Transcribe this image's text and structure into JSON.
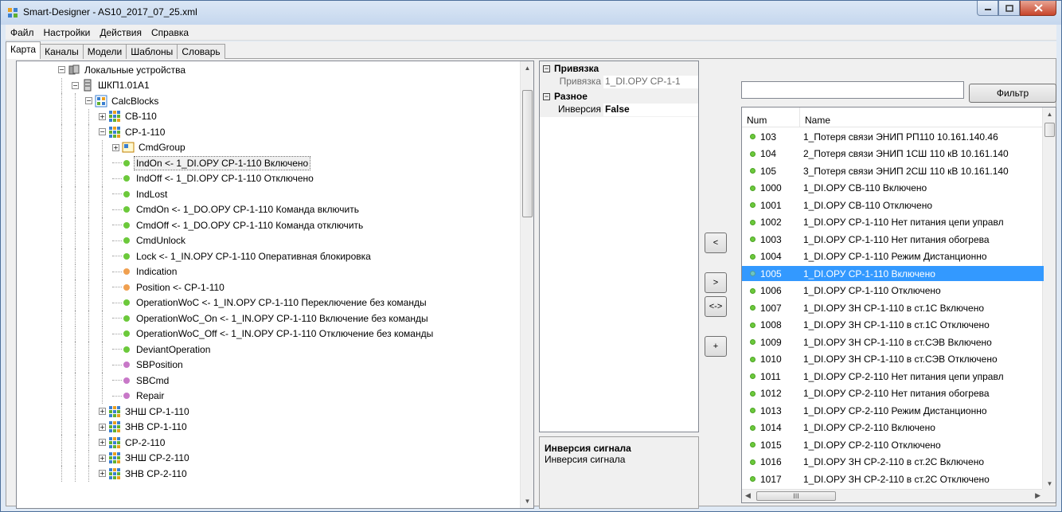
{
  "window": {
    "title": "Smart-Designer - AS10_2017_07_25.xml"
  },
  "menu": [
    "Файл",
    "Настройки",
    "Действия",
    "Справка"
  ],
  "tabs": [
    "Карта",
    "Каналы",
    "Модели",
    "Шаблоны",
    "Словарь"
  ],
  "tree": [
    {
      "label": "Локальные устройства",
      "level": 0,
      "icon": "devices-icon",
      "expander": "−"
    },
    {
      "label": "ШКП1.01А1",
      "level": 1,
      "icon": "cabinet-icon",
      "expander": "−"
    },
    {
      "label": "CalcBlocks",
      "level": 2,
      "icon": "calcblocks-icon",
      "expander": "−"
    },
    {
      "label": "СВ-110",
      "level": 3,
      "icon": "block-icon",
      "expander": "+"
    },
    {
      "label": "СР-1-110",
      "level": 3,
      "icon": "block-icon",
      "expander": "−"
    },
    {
      "label": "CmdGroup",
      "level": 4,
      "icon": "group-icon",
      "expander": "+"
    },
    {
      "label": "IndOn <- 1_DI.ОРУ СР-1-110 Включено",
      "level": 4,
      "dot": "#6cc93b",
      "selected": true
    },
    {
      "label": "IndOff <- 1_DI.ОРУ СР-1-110 Отключено",
      "level": 4,
      "dot": "#6cc93b"
    },
    {
      "label": "IndLost",
      "level": 4,
      "dot": "#6cc93b"
    },
    {
      "label": "CmdOn <- 1_DO.ОРУ СР-1-110 Команда включить",
      "level": 4,
      "dot": "#6cc93b"
    },
    {
      "label": "CmdOff <- 1_DO.ОРУ СР-1-110 Команда отключить",
      "level": 4,
      "dot": "#6cc93b"
    },
    {
      "label": "CmdUnlock",
      "level": 4,
      "dot": "#6cc93b"
    },
    {
      "label": "Lock <- 1_IN.ОРУ СР-1-110 Оперативная блокировка",
      "level": 4,
      "dot": "#6cc93b"
    },
    {
      "label": "Indication",
      "level": 4,
      "dot": "#f0a050"
    },
    {
      "label": "Position <- СР-1-110",
      "level": 4,
      "dot": "#f0a050"
    },
    {
      "label": "OperationWoC <- 1_IN.ОРУ СР-1-110 Переключение без команды",
      "level": 4,
      "dot": "#6cc93b"
    },
    {
      "label": "OperationWoC_On <- 1_IN.ОРУ СР-1-110 Включение без команды",
      "level": 4,
      "dot": "#6cc93b"
    },
    {
      "label": "OperationWoC_Off <- 1_IN.ОРУ СР-1-110 Отключение без команды",
      "level": 4,
      "dot": "#6cc93b"
    },
    {
      "label": "DeviantOperation",
      "level": 4,
      "dot": "#6cc93b"
    },
    {
      "label": "SBPosition",
      "level": 4,
      "dot": "#c878c8"
    },
    {
      "label": "SBCmd",
      "level": 4,
      "dot": "#c878c8"
    },
    {
      "label": "Repair",
      "level": 4,
      "dot": "#c878c8"
    },
    {
      "label": "ЗНШ СР-1-110",
      "level": 3,
      "icon": "block-icon",
      "expander": "+"
    },
    {
      "label": "ЗНВ СР-1-110",
      "level": 3,
      "icon": "block-icon",
      "expander": "+"
    },
    {
      "label": "СР-2-110",
      "level": 3,
      "icon": "block-icon",
      "expander": "+"
    },
    {
      "label": "ЗНШ СР-2-110",
      "level": 3,
      "icon": "block-icon",
      "expander": "+"
    },
    {
      "label": "ЗНВ СР-2-110",
      "level": 3,
      "icon": "block-icon",
      "expander": "+"
    }
  ],
  "props": {
    "cat1": "Привязка",
    "row1_name": "Привязка",
    "row1_value": "1_DI.ОРУ СР-1-1",
    "cat2": "Разное",
    "row2_name": "Инверсия",
    "row2_value": "False",
    "help_title": "Инверсия сигнала",
    "help_text": "Инверсия сигнала"
  },
  "mid_buttons": [
    "<",
    ">",
    "<->",
    "+"
  ],
  "filter": {
    "value": "",
    "button": "Фильтр"
  },
  "list": {
    "headers": [
      "Num",
      "Name"
    ],
    "rows": [
      [
        "103",
        "1_Потеря связи ЭНИП РП110 10.161.140.46"
      ],
      [
        "104",
        "2_Потеря связи ЭНИП 1СШ 110 кВ 10.161.140"
      ],
      [
        "105",
        "3_Потеря связи ЭНИП 2СШ 110 кВ 10.161.140"
      ],
      [
        "1000",
        "1_DI.ОРУ СВ-110 Включено"
      ],
      [
        "1001",
        "1_DI.ОРУ СВ-110 Отключено"
      ],
      [
        "1002",
        "1_DI.ОРУ СР-1-110 Нет питания цепи управл"
      ],
      [
        "1003",
        "1_DI.ОРУ СР-1-110 Нет питания обогрева"
      ],
      [
        "1004",
        "1_DI.ОРУ СР-1-110 Режим Дистанционно"
      ],
      [
        "1005",
        "1_DI.ОРУ СР-1-110 Включено"
      ],
      [
        "1006",
        "1_DI.ОРУ СР-1-110 Отключено"
      ],
      [
        "1007",
        "1_DI.ОРУ ЗН СР-1-110 в ст.1С Включено"
      ],
      [
        "1008",
        "1_DI.ОРУ ЗН СР-1-110 в ст.1С Отключено"
      ],
      [
        "1009",
        "1_DI.ОРУ ЗН СР-1-110 в ст.СЭВ Включено"
      ],
      [
        "1010",
        "1_DI.ОРУ ЗН СР-1-110 в ст.СЭВ Отключено"
      ],
      [
        "1011",
        "1_DI.ОРУ СР-2-110 Нет питания цепи управл"
      ],
      [
        "1012",
        "1_DI.ОРУ СР-2-110 Нет питания обогрева"
      ],
      [
        "1013",
        "1_DI.ОРУ СР-2-110 Режим Дистанционно"
      ],
      [
        "1014",
        "1_DI.ОРУ СР-2-110 Включено"
      ],
      [
        "1015",
        "1_DI.ОРУ СР-2-110 Отключено"
      ],
      [
        "1016",
        "1_DI.ОРУ ЗН СР-2-110 в ст.2С Включено"
      ],
      [
        "1017",
        "1_DI.ОРУ ЗН СР-2-110 в ст.2С Отключено"
      ]
    ],
    "selected": "1005",
    "hscroll_thumb": "III"
  }
}
